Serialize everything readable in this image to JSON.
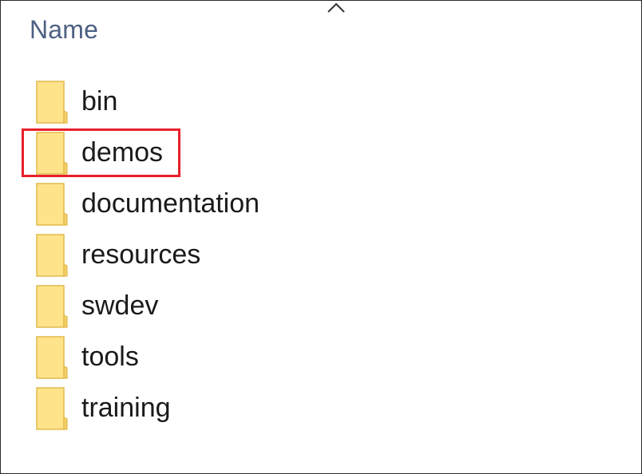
{
  "header": {
    "column_name": "Name",
    "sort_icon": "chevron-up-icon"
  },
  "folders": [
    {
      "name": "bin",
      "icon": "folder-icon"
    },
    {
      "name": "demos",
      "icon": "folder-icon",
      "highlighted": true
    },
    {
      "name": "documentation",
      "icon": "folder-icon"
    },
    {
      "name": "resources",
      "icon": "folder-icon"
    },
    {
      "name": "swdev",
      "icon": "folder-icon"
    },
    {
      "name": "tools",
      "icon": "folder-icon"
    },
    {
      "name": "training",
      "icon": "folder-icon"
    }
  ],
  "colors": {
    "folder_fill": "#ffe38a",
    "folder_edge": "#e2b94a",
    "header_text": "#4d6082",
    "highlight": "#e8202a"
  }
}
